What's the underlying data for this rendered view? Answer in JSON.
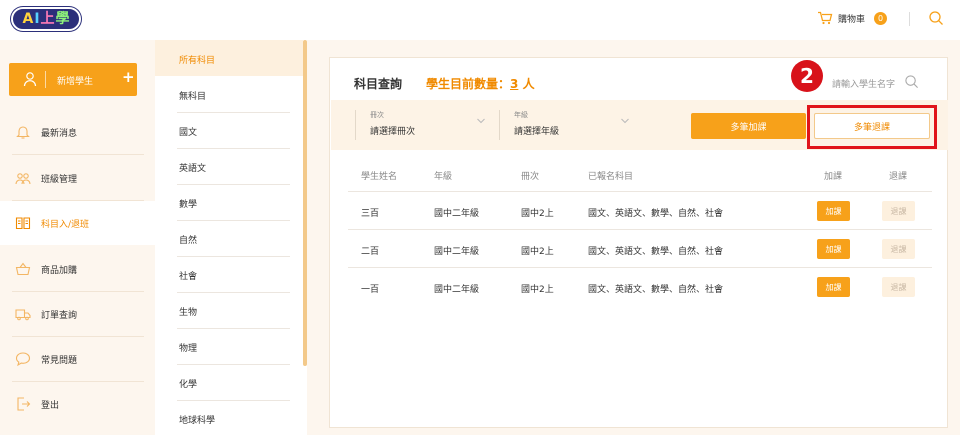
{
  "brand": {
    "logo_text": "AI上學"
  },
  "header": {
    "cart_label": "購物車",
    "cart_count": "0"
  },
  "sidebar": {
    "add_student_label": "新增學生",
    "add_student_plus": "+",
    "items": [
      {
        "label": "最新消息",
        "icon": "bell-icon"
      },
      {
        "label": "班級管理",
        "icon": "people-icon"
      },
      {
        "label": "科目入/退班",
        "icon": "book-icon",
        "active": true
      },
      {
        "label": "商品加購",
        "icon": "basket-icon"
      },
      {
        "label": "訂單查詢",
        "icon": "truck-icon"
      },
      {
        "label": "常見問題",
        "icon": "chat-icon"
      },
      {
        "label": "登出",
        "icon": "logout-icon"
      }
    ]
  },
  "subjects": {
    "items": [
      "所有科目",
      "無科目",
      "國文",
      "英語文",
      "數學",
      "自然",
      "社會",
      "生物",
      "物理",
      "化學",
      "地球科學"
    ],
    "active_index": 0
  },
  "main": {
    "title": "科目查詢",
    "count_label": "學生目前數量：",
    "count_value": "3",
    "count_unit": "人",
    "search_placeholder": "請輸入學生名字",
    "step_badge": "2",
    "filters": {
      "volume": {
        "caption": "冊次",
        "value": "請選擇冊次"
      },
      "grade": {
        "caption": "年級",
        "value": "請選擇年級"
      }
    },
    "add_multi_label": "多筆加課",
    "drop_multi_label": "多筆退課",
    "table": {
      "headers": [
        "學生姓名",
        "年級",
        "冊次",
        "已報名科目",
        "加課",
        "退課"
      ],
      "rows": [
        {
          "name": "三百",
          "grade": "國中二年級",
          "volume": "國中2上",
          "subjects": "國文、英語文、數學、自然、社會",
          "add": "加課",
          "drop": "退課"
        },
        {
          "name": "二百",
          "grade": "國中二年級",
          "volume": "國中2上",
          "subjects": "國文、英語文、數學、自然、社會",
          "add": "加課",
          "drop": "退課"
        },
        {
          "name": "一百",
          "grade": "國中二年級",
          "volume": "國中2上",
          "subjects": "國文、英語文、數學、自然、社會",
          "add": "加課",
          "drop": "退課"
        }
      ]
    }
  },
  "colors": {
    "accent": "#f7a11a",
    "accent_text": "#f08a00",
    "highlight": "#e0141b"
  }
}
